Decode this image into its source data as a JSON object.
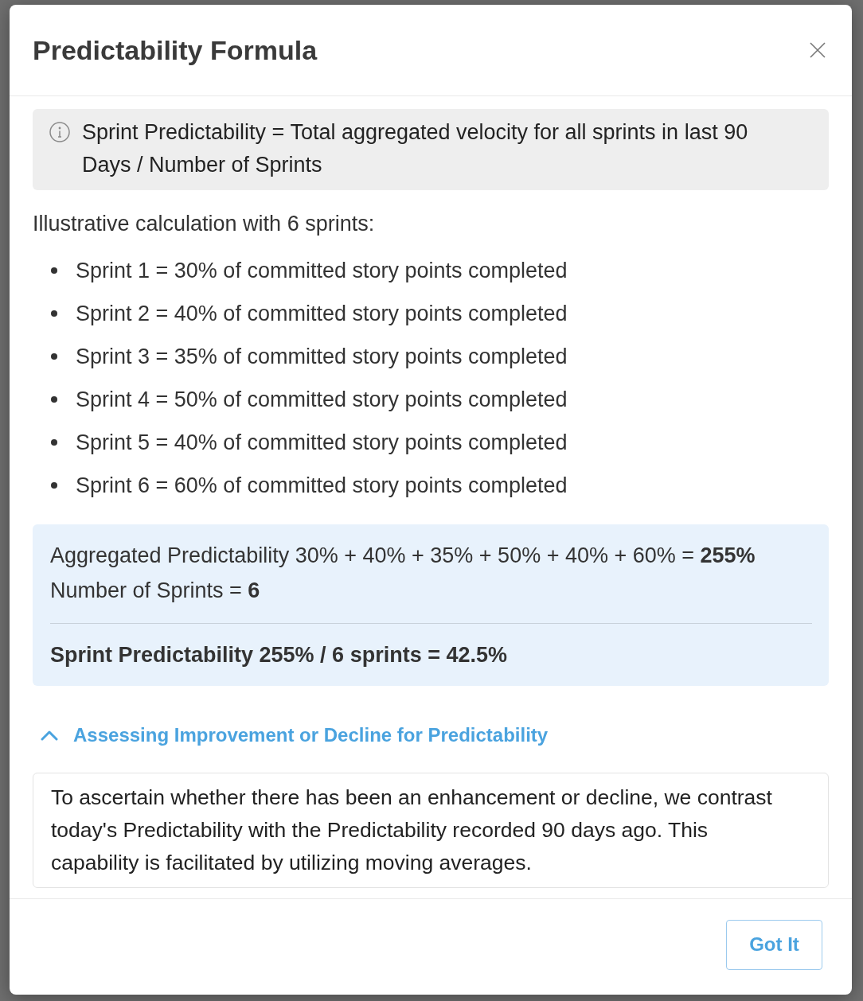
{
  "dialog": {
    "title": "Predictability Formula"
  },
  "formula_note": {
    "text": "Sprint Predictability = Total aggregated velocity for all sprints in last 90 Days / Number of Sprints"
  },
  "intro": "Illustrative calculation with 6 sprints:",
  "sprints": [
    "Sprint 1 = 30% of committed story points completed",
    "Sprint 2 = 40% of committed story points completed",
    "Sprint 3 = 35% of committed story points completed",
    "Sprint 4 = 50% of committed story points completed",
    "Sprint 5 = 40% of committed story points completed",
    "Sprint 6 = 60% of committed story points completed"
  ],
  "summary": {
    "lines": [
      "Aggregated Predictability 30% + 40% + 35% + 50% + 40% + 60% = **255%**",
      "Number of Sprints = **6**"
    ],
    "result": "Sprint Predictability 255% / 6 sprints = 42.5%"
  },
  "accordion": {
    "title": "Assessing Improvement or Decline for Predictability",
    "expanded": true,
    "body": "To ascertain whether there has been an enhancement or decline, we contrast today's Predictability with the Predictability recorded 90 days ago. This capability is facilitated by utilizing moving averages."
  },
  "buttons": [
    "Got It"
  ]
}
